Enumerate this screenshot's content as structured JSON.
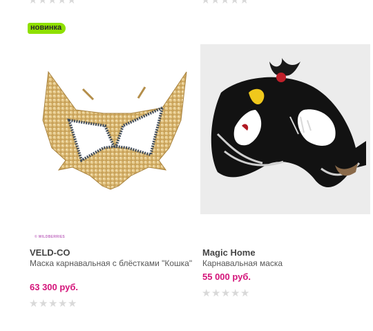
{
  "top_row": {
    "rating_left": 0,
    "rating_right": 0
  },
  "products": [
    {
      "badge": "новинка",
      "watermark": "© WILDBERRIES",
      "brand": "VELD-CO",
      "description": "Маска карнавальная с блёстками \"Кошка\"",
      "price": "63 300 руб.",
      "rating": 0
    },
    {
      "brand": "Magic Home",
      "description": "Карнавальная маска",
      "price": "55 000 руб.",
      "rating": 0
    }
  ],
  "star_glyph": "★",
  "colors": {
    "badge_bg": "#8fe000",
    "price": "#d4147a",
    "star_empty": "#d9d9d9"
  }
}
